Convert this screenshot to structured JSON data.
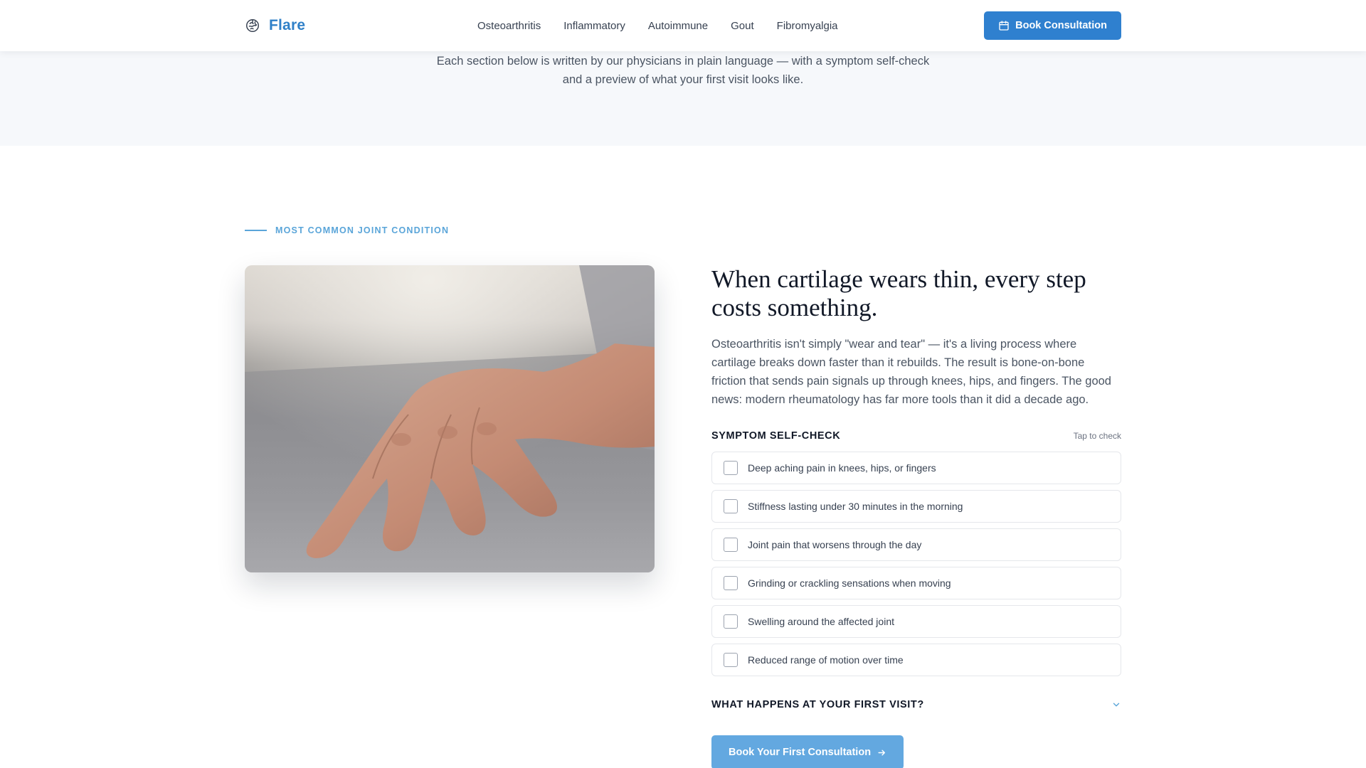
{
  "brand": {
    "name": "Flare",
    "logo_icon": "brain-icon",
    "accent": "#2f80c8"
  },
  "nav": {
    "links": [
      "Osteoarthritis",
      "Inflammatory",
      "Autoimmune",
      "Gout",
      "Fibromyalgia"
    ],
    "cta_label": "Book Consultation",
    "cta_icon": "calendar-icon"
  },
  "hero": {
    "subtitle_line1": "Each section below is written by our physicians in plain language — with a symptom self-check",
    "subtitle_line2": "and a preview of what your first visit looks like."
  },
  "section": {
    "eyebrow": "MOST COMMON JOINT CONDITION",
    "image_subject": "hand resting on a table",
    "headline": "When cartilage wears thin, every step costs something.",
    "body": "Osteoarthritis isn't simply \"wear and tear\" — it's a living process where cartilage breaks down faster than it rebuilds. The result is bone-on-bone friction that sends pain signals up through knees, hips, and fingers. The good news: modern rheumatology has far more tools than it did a decade ago.",
    "self_check": {
      "title": "SYMPTOM SELF-CHECK",
      "hint": "Tap to check",
      "items": [
        "Deep aching pain in knees, hips, or fingers",
        "Stiffness lasting under 30 minutes in the morning",
        "Joint pain that worsens through the day",
        "Grinding or crackling sensations when moving",
        "Swelling around the affected joint",
        "Reduced range of motion over time"
      ]
    },
    "visit_toggle": "WHAT HAPPENS AT YOUR FIRST VISIT?",
    "book_button": "Book Your First Consultation"
  }
}
